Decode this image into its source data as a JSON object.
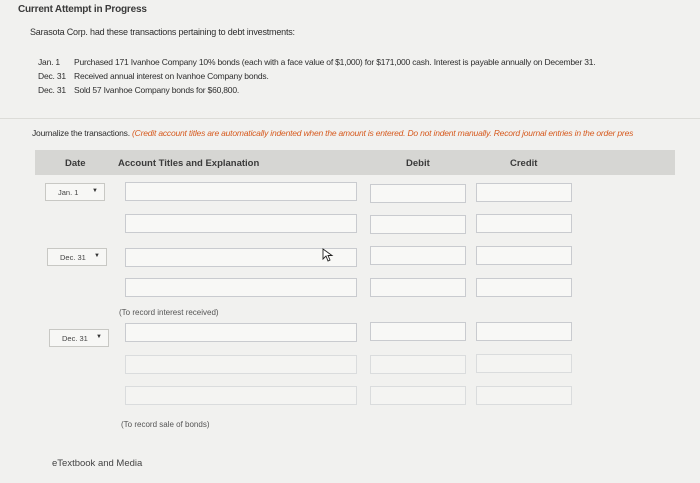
{
  "header": {
    "status": "Current Attempt in Progress"
  },
  "problem": {
    "intro": "Sarasota Corp. had these transactions pertaining to debt investments:",
    "transactions": [
      {
        "date": "Jan. 1",
        "text": "Purchased 171 Ivanhoe Company 10% bonds (each with a face value of $1,000) for $171,000 cash. Interest is payable annually on December 31."
      },
      {
        "date": "Dec. 31",
        "text": "Received annual interest on Ivanhoe Company bonds."
      },
      {
        "date": "Dec. 31",
        "text": "Sold 57 Ivanhoe Company bonds for $60,800."
      }
    ]
  },
  "instructions": {
    "lead": "Journalize the transactions.",
    "note": "(Credit account titles are automatically indented when the amount is entered. Do not indent manually. Record journal entries in the order pres"
  },
  "table": {
    "col_date": "Date",
    "col_account": "Account Titles and Explanation",
    "col_debit": "Debit",
    "col_credit": "Credit"
  },
  "entries": [
    {
      "date_value": "Jan. 1",
      "memo": ""
    },
    {
      "date_value": "Dec. 31",
      "memo": "(To record interest received)"
    },
    {
      "date_value": "Dec. 31",
      "memo": "(To record sale of bonds)"
    }
  ],
  "footer": {
    "etextbook": "eTextbook and Media"
  },
  "icons": {
    "dropdown": "triangle-down-icon",
    "cursor": "mouse-pointer-icon"
  },
  "colors": {
    "note": "#d65a1e",
    "header_bg": "#d6d6d3",
    "page_bg": "#f1f1ef"
  }
}
